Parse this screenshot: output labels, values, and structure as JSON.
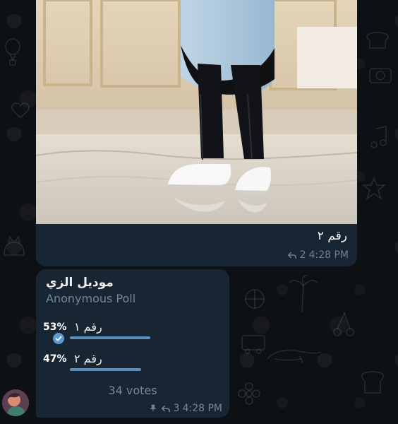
{
  "photo_message": {
    "caption": "رقم ٢",
    "forward_count": "2",
    "time": "4:28 PM"
  },
  "poll_message": {
    "question": "موديل الزي",
    "type": "Anonymous Poll",
    "options": [
      {
        "label": "رقم ١",
        "percent_text": "53%",
        "percent": 53,
        "selected": true
      },
      {
        "label": "رقم ٢",
        "percent_text": "47%",
        "percent": 47,
        "selected": false
      }
    ],
    "votes_text": "34 votes",
    "forward_count": "3",
    "time": "4:28 PM"
  },
  "icons": {
    "reply": "reply-icon",
    "pin": "pin-icon",
    "check": "check-icon"
  },
  "colors": {
    "background": "#0e1114",
    "bubble": "#182533",
    "accent": "#5d8fbd",
    "meta": "#73879a"
  }
}
